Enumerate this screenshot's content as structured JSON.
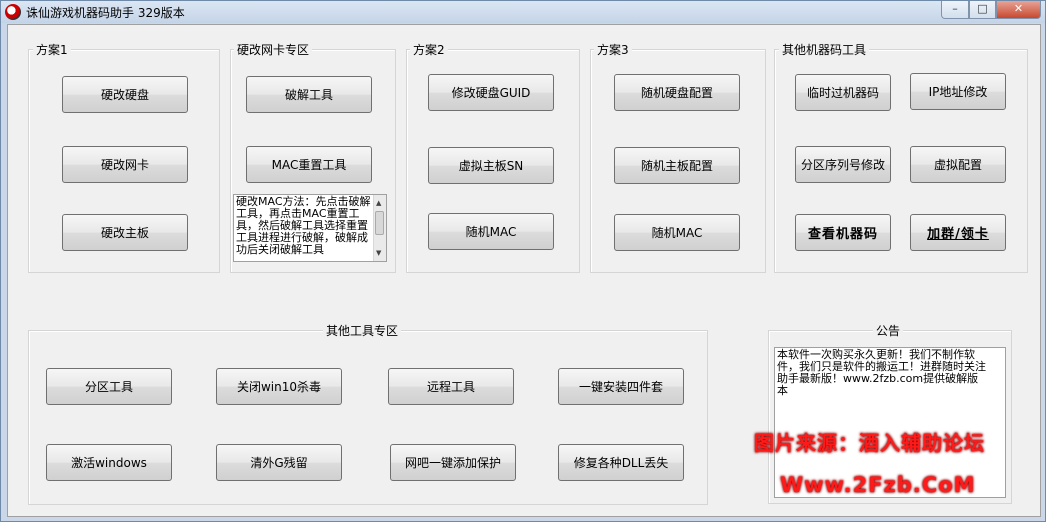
{
  "window": {
    "title": "诛仙游戏机器码助手  329版本",
    "min": "–",
    "max": "□",
    "close": "✕"
  },
  "groups": {
    "plan1": {
      "label": "方案1",
      "buttons": [
        "硬改硬盘",
        "硬改网卡",
        "硬改主板"
      ]
    },
    "nic": {
      "label": "硬改网卡专区",
      "buttons": [
        "破解工具",
        "MAC重置工具"
      ],
      "notes": "硬改MAC方法：先点击破解工具，再点击MAC重置工具，然后破解工具选择重置工具进程进行破解，破解成功后关闭破解工具"
    },
    "plan2": {
      "label": "方案2",
      "buttons": [
        "修改硬盘GUID",
        "虚拟主板SN",
        "随机MAC"
      ]
    },
    "plan3": {
      "label": "方案3",
      "buttons": [
        "随机硬盘配置",
        "随机主板配置",
        "随机MAC"
      ]
    },
    "other_mc": {
      "label": "其他机器码工具",
      "buttons": [
        "临时过机器码",
        "IP地址修改",
        "分区序列号修改",
        "虚拟配置",
        "查看机器码",
        "加群/领卡"
      ]
    },
    "tools": {
      "label": "其他工具专区",
      "buttons": [
        "分区工具",
        "关闭win10杀毒",
        "远程工具",
        "一键安装四件套",
        "激活windows",
        "清外G残留",
        "网吧一键添加保护",
        "修复各种DLL丢失"
      ]
    },
    "notice": {
      "label": "公告",
      "text": "本软件一次购买永久更新！我们不制作软件，我们只是软件的搬运工！进群随时关注助手最新版！www.2fzb.com提供破解版本"
    }
  },
  "watermark": {
    "line1": "图片来源：酒入辅助论坛",
    "line2": "Www.2Fzb.CoM",
    "color": "#ff1a1a"
  }
}
